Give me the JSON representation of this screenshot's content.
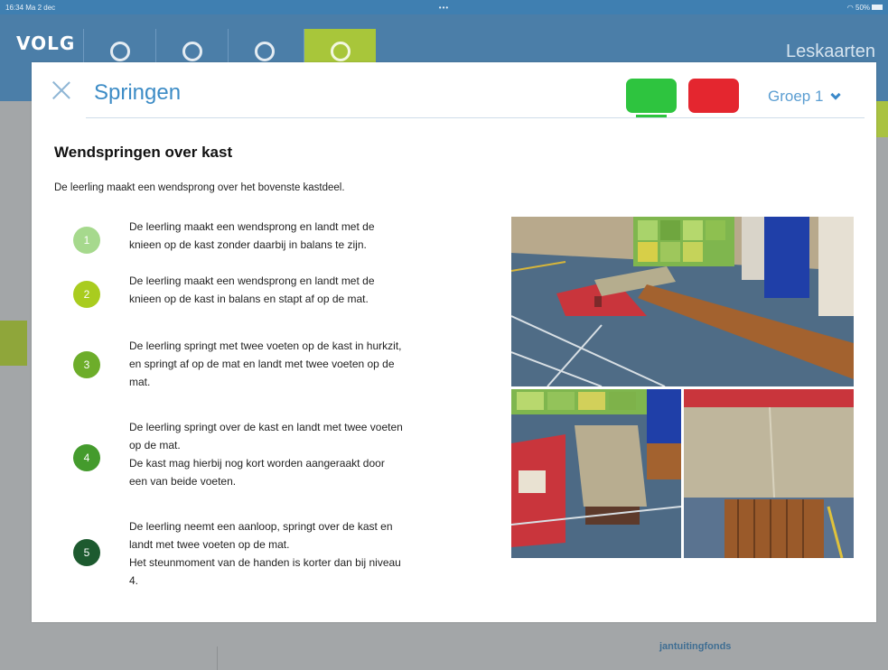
{
  "status_bar": {
    "time_date": "16:34  Ma 2 dec",
    "dots": "•••",
    "battery": "50%"
  },
  "app": {
    "logo": "VOLG",
    "title": "Leskaarten",
    "footer_brand": "jantuitingfonds",
    "footer_left": ""
  },
  "modal": {
    "title": "Springen",
    "group_selector": "Groep 1",
    "subtitle": "Wendspringen over kast",
    "description": "De leerling maakt een wendsprong over het bovenste kastdeel.",
    "levels": [
      {
        "num": "1",
        "color": "#a6d98d",
        "text": "De leerling maakt een wendsprong en landt met de\nknieen op de kast zonder daarbij in balans te zijn."
      },
      {
        "num": "2",
        "color": "#a9cc1f",
        "text": "De leerling maakt een wendsprong en landt met de\nknieen op de kast in balans en stapt af op de mat."
      },
      {
        "num": "3",
        "color": "#6dad2a",
        "text": "De leerling springt met twee voeten op de kast in hurkzit,\nen springt af op de mat en landt met twee voeten op de\nmat."
      },
      {
        "num": "4",
        "color": "#449b2d",
        "text": "De leerling springt over de kast en landt met twee voeten\nop de mat.\nDe kast mag hierbij nog kort worden aangeraakt door\neen van beide voeten."
      },
      {
        "num": "5",
        "color": "#1d5a2f",
        "text": "De leerling neemt een aanloop, springt over de kast en\nlandt met twee voeten op de mat.\nHet steunmoment van de handen is korter dan bij niveau\n4."
      }
    ]
  },
  "colors": {
    "accent_blue": "#3d8cc6",
    "green": "#2ec43f",
    "red": "#e4262f"
  }
}
